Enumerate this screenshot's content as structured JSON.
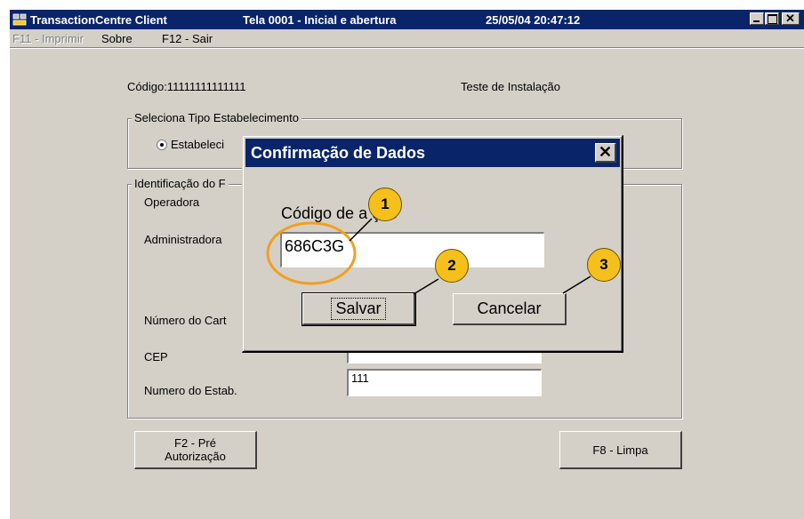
{
  "window": {
    "app_title": "TransactionCentre Client",
    "screen_title": "Tela 0001 - Inicial e abertura",
    "datetime": "25/05/04 20:47:12"
  },
  "menu": {
    "print": "F11 - Imprimir",
    "about": "Sobre",
    "exit": "F12 - Sair"
  },
  "main": {
    "code_label": "Código:11111111111111",
    "install_label": "Teste de Instalação",
    "group_establishment_type": "Seleciona Tipo Estabelecimento",
    "radio_establishment": "Estabeleci",
    "group_identification": "Identificação do F",
    "operator_label": "Operadora",
    "administrator_label": "Administradora",
    "card_number_label": "Número do Cart",
    "cep_label": "CEP",
    "estab_number_label": "Numero do Estab.",
    "estab_number_value": "111",
    "cep_value": "",
    "btn_preauth_line1": "F2 - Pré",
    "btn_preauth_line2": "Autorização",
    "btn_clear": "F8 - Limpa"
  },
  "dialog": {
    "title": "Confirmação de Dados",
    "field_label": "Código de a     ção",
    "field_value": "686C3G",
    "save_label": "Salvar",
    "cancel_label": "Cancelar",
    "close_glyph": "✕"
  },
  "callouts": [
    "1",
    "2",
    "3"
  ],
  "colors": {
    "titlebar": "#0a246a",
    "face": "#d4d0c8",
    "callout_fill": "#f5c01b",
    "highlight_ring": "#f0a020"
  }
}
